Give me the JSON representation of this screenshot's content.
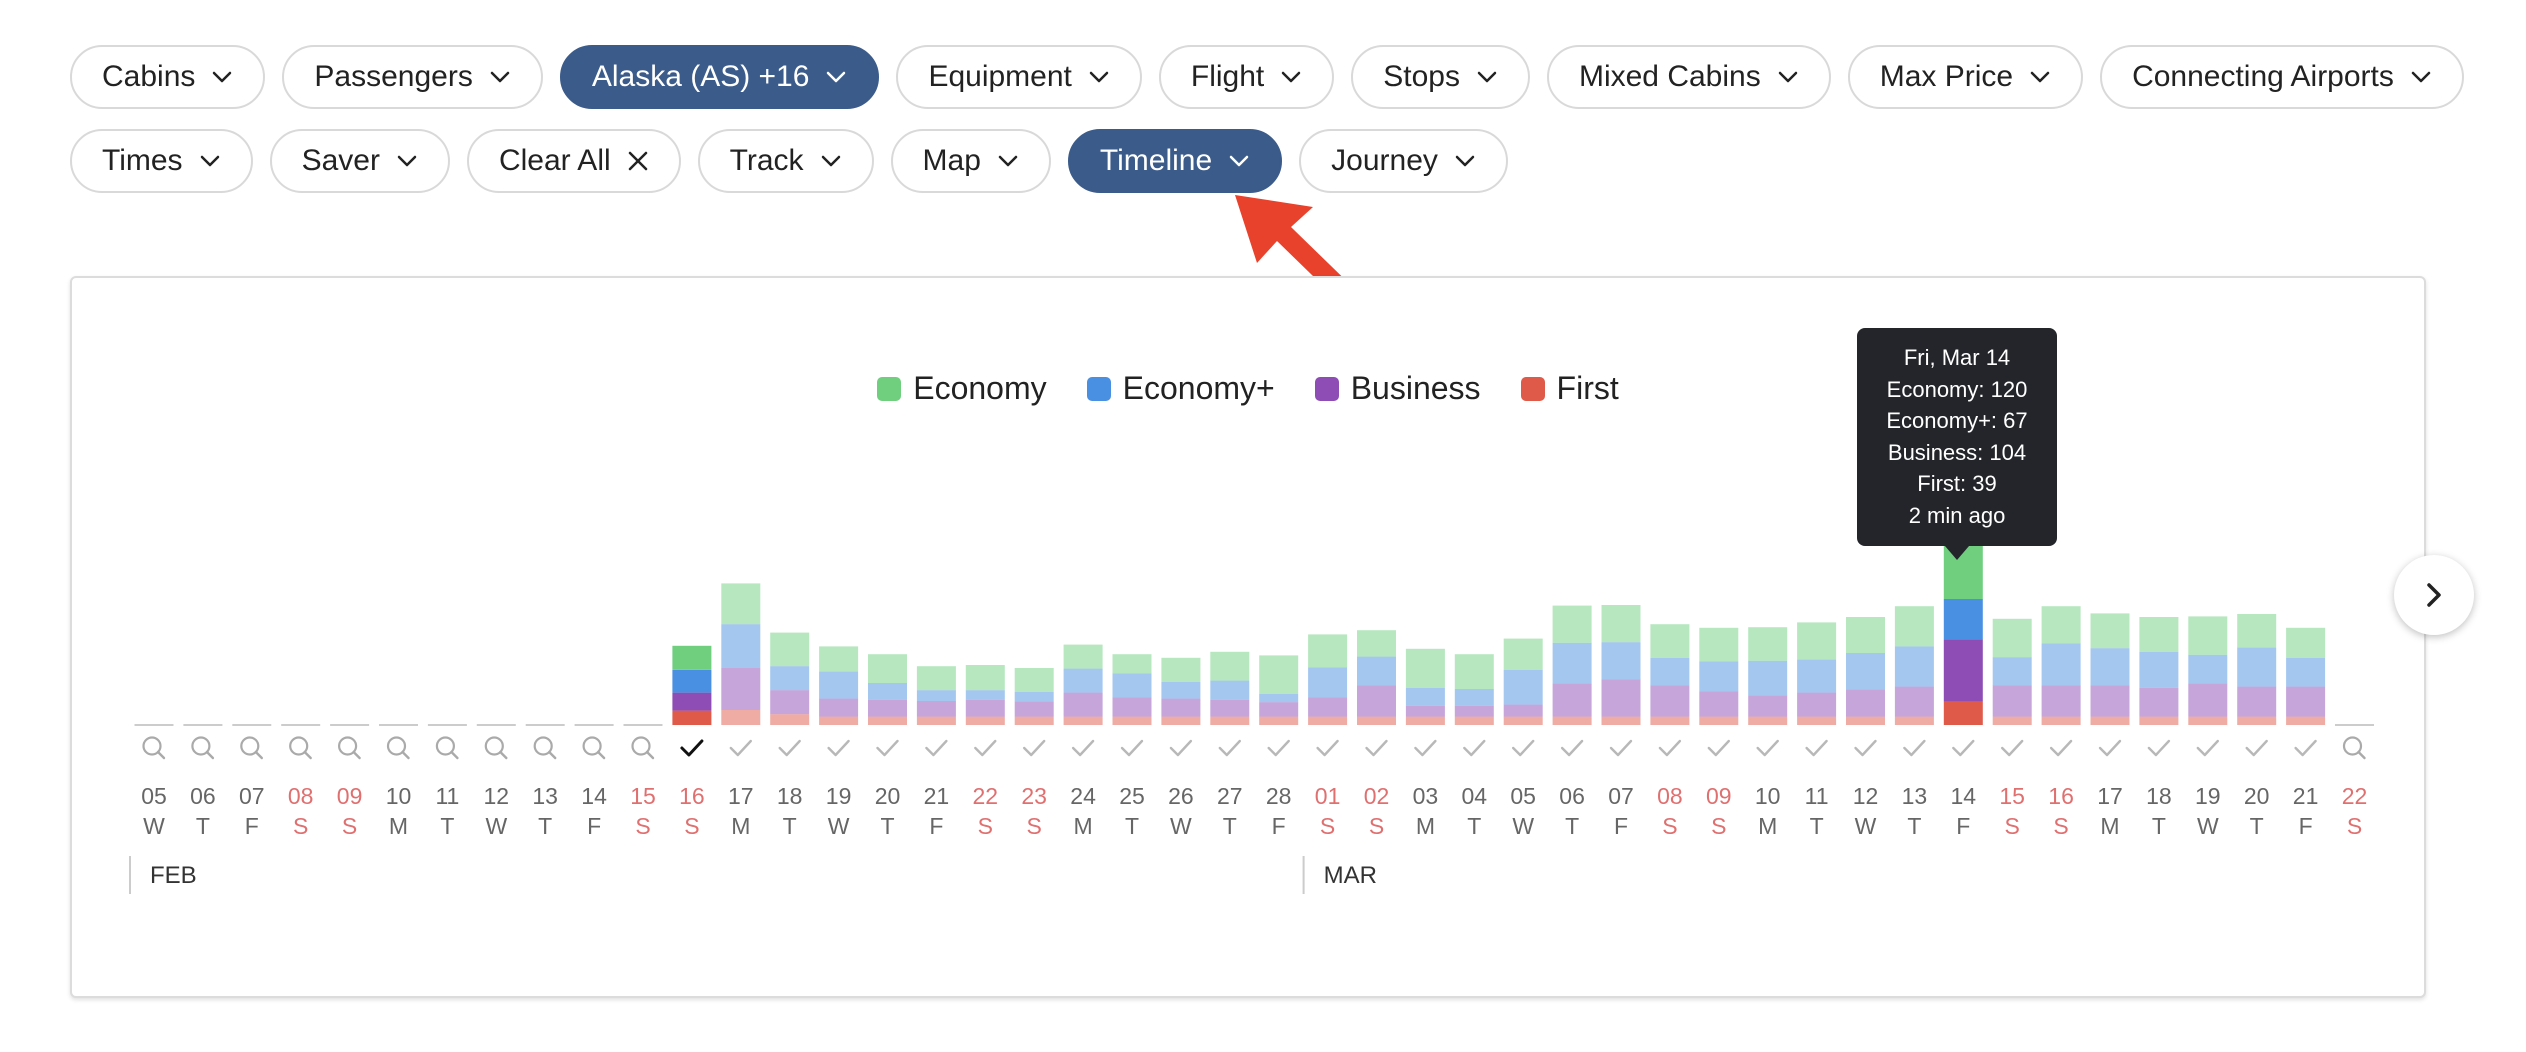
{
  "filters": {
    "row1": [
      {
        "label": "Cabins",
        "active": false,
        "icon": "chevron-down-icon"
      },
      {
        "label": "Passengers",
        "active": false,
        "icon": "chevron-down-icon"
      },
      {
        "label": "Alaska (AS) +16",
        "active": true,
        "icon": "chevron-down-icon"
      },
      {
        "label": "Equipment",
        "active": false,
        "icon": "chevron-down-icon"
      },
      {
        "label": "Flight",
        "active": false,
        "icon": "chevron-down-icon"
      },
      {
        "label": "Stops",
        "active": false,
        "icon": "chevron-down-icon"
      },
      {
        "label": "Mixed Cabins",
        "active": false,
        "icon": "chevron-down-icon"
      },
      {
        "label": "Max Price",
        "active": false,
        "icon": "chevron-down-icon"
      },
      {
        "label": "Connecting Airports",
        "active": false,
        "icon": "chevron-down-icon"
      }
    ],
    "row2": [
      {
        "label": "Times",
        "active": false,
        "icon": "chevron-down-icon"
      },
      {
        "label": "Saver",
        "active": false,
        "icon": "chevron-down-icon"
      },
      {
        "label": "Clear All",
        "active": false,
        "icon": "close-icon"
      },
      {
        "label": "Track",
        "active": false,
        "icon": "chevron-down-icon"
      },
      {
        "label": "Map",
        "active": false,
        "icon": "chevron-down-icon"
      },
      {
        "label": "Timeline",
        "active": true,
        "icon": "chevron-down-icon"
      },
      {
        "label": "Journey",
        "active": false,
        "icon": "chevron-down-icon"
      }
    ]
  },
  "colors": {
    "accent": "#3b5b8a",
    "economy": "#6fcf7f",
    "economy_plus": "#4a90e2",
    "business": "#8e4cb5",
    "first": "#e05a4a",
    "weekend_text": "#e07070",
    "annotation_arrow": "#e8412c"
  },
  "legend": [
    {
      "label": "Economy",
      "color": "#6fcf7f"
    },
    {
      "label": "Economy+",
      "color": "#4a90e2"
    },
    {
      "label": "Business",
      "color": "#8e4cb5"
    },
    {
      "label": "First",
      "color": "#e05a4a"
    }
  ],
  "tooltip": {
    "lines": [
      "Fri, Mar 14",
      "Economy: 120",
      "Economy+: 67",
      "Business: 104",
      "First: 39",
      "2 min ago"
    ]
  },
  "months": [
    "FEB",
    "MAR"
  ],
  "chart_data": {
    "type": "bar",
    "stacked": true,
    "categories": [
      {
        "day": "05",
        "dow": "W",
        "weekend": false,
        "status": "search",
        "month": "FEB"
      },
      {
        "day": "06",
        "dow": "T",
        "weekend": false,
        "status": "search",
        "month": "FEB"
      },
      {
        "day": "07",
        "dow": "F",
        "weekend": false,
        "status": "search",
        "month": "FEB"
      },
      {
        "day": "08",
        "dow": "S",
        "weekend": true,
        "status": "search",
        "month": "FEB"
      },
      {
        "day": "09",
        "dow": "S",
        "weekend": true,
        "status": "search",
        "month": "FEB"
      },
      {
        "day": "10",
        "dow": "M",
        "weekend": false,
        "status": "search",
        "month": "FEB"
      },
      {
        "day": "11",
        "dow": "T",
        "weekend": false,
        "status": "search",
        "month": "FEB"
      },
      {
        "day": "12",
        "dow": "W",
        "weekend": false,
        "status": "search",
        "month": "FEB"
      },
      {
        "day": "13",
        "dow": "T",
        "weekend": false,
        "status": "search",
        "month": "FEB"
      },
      {
        "day": "14",
        "dow": "F",
        "weekend": false,
        "status": "search",
        "month": "FEB"
      },
      {
        "day": "15",
        "dow": "S",
        "weekend": true,
        "status": "search",
        "month": "FEB"
      },
      {
        "day": "16",
        "dow": "S",
        "weekend": true,
        "status": "selected",
        "month": "FEB"
      },
      {
        "day": "17",
        "dow": "M",
        "weekend": false,
        "status": "check",
        "month": "FEB"
      },
      {
        "day": "18",
        "dow": "T",
        "weekend": false,
        "status": "check",
        "month": "FEB"
      },
      {
        "day": "19",
        "dow": "W",
        "weekend": false,
        "status": "check",
        "month": "FEB"
      },
      {
        "day": "20",
        "dow": "T",
        "weekend": false,
        "status": "check",
        "month": "FEB"
      },
      {
        "day": "21",
        "dow": "F",
        "weekend": false,
        "status": "check",
        "month": "FEB"
      },
      {
        "day": "22",
        "dow": "S",
        "weekend": true,
        "status": "check",
        "month": "FEB"
      },
      {
        "day": "23",
        "dow": "S",
        "weekend": true,
        "status": "check",
        "month": "FEB"
      },
      {
        "day": "24",
        "dow": "M",
        "weekend": false,
        "status": "check",
        "month": "FEB"
      },
      {
        "day": "25",
        "dow": "T",
        "weekend": false,
        "status": "check",
        "month": "FEB"
      },
      {
        "day": "26",
        "dow": "W",
        "weekend": false,
        "status": "check",
        "month": "FEB"
      },
      {
        "day": "27",
        "dow": "T",
        "weekend": false,
        "status": "check",
        "month": "FEB"
      },
      {
        "day": "28",
        "dow": "F",
        "weekend": false,
        "status": "check",
        "month": "FEB"
      },
      {
        "day": "01",
        "dow": "S",
        "weekend": true,
        "status": "check",
        "month": "MAR"
      },
      {
        "day": "02",
        "dow": "S",
        "weekend": true,
        "status": "check",
        "month": "MAR"
      },
      {
        "day": "03",
        "dow": "M",
        "weekend": false,
        "status": "check",
        "month": "MAR"
      },
      {
        "day": "04",
        "dow": "T",
        "weekend": false,
        "status": "check",
        "month": "MAR"
      },
      {
        "day": "05",
        "dow": "W",
        "weekend": false,
        "status": "check",
        "month": "MAR"
      },
      {
        "day": "06",
        "dow": "T",
        "weekend": false,
        "status": "check",
        "month": "MAR"
      },
      {
        "day": "07",
        "dow": "F",
        "weekend": false,
        "status": "check",
        "month": "MAR"
      },
      {
        "day": "08",
        "dow": "S",
        "weekend": true,
        "status": "check",
        "month": "MAR"
      },
      {
        "day": "09",
        "dow": "S",
        "weekend": true,
        "status": "check",
        "month": "MAR"
      },
      {
        "day": "10",
        "dow": "M",
        "weekend": false,
        "status": "check",
        "month": "MAR"
      },
      {
        "day": "11",
        "dow": "T",
        "weekend": false,
        "status": "check",
        "month": "MAR"
      },
      {
        "day": "12",
        "dow": "W",
        "weekend": false,
        "status": "check",
        "month": "MAR"
      },
      {
        "day": "13",
        "dow": "T",
        "weekend": false,
        "status": "check",
        "month": "MAR"
      },
      {
        "day": "14",
        "dow": "F",
        "weekend": false,
        "status": "check",
        "month": "MAR"
      },
      {
        "day": "15",
        "dow": "S",
        "weekend": true,
        "status": "check",
        "month": "MAR"
      },
      {
        "day": "16",
        "dow": "S",
        "weekend": true,
        "status": "check",
        "month": "MAR"
      },
      {
        "day": "17",
        "dow": "M",
        "weekend": false,
        "status": "check",
        "month": "MAR"
      },
      {
        "day": "18",
        "dow": "T",
        "weekend": false,
        "status": "check",
        "month": "MAR"
      },
      {
        "day": "19",
        "dow": "W",
        "weekend": false,
        "status": "check",
        "month": "MAR"
      },
      {
        "day": "20",
        "dow": "T",
        "weekend": false,
        "status": "check",
        "month": "MAR"
      },
      {
        "day": "21",
        "dow": "F",
        "weekend": false,
        "status": "check",
        "month": "MAR"
      },
      {
        "day": "22",
        "dow": "S",
        "weekend": true,
        "status": "search",
        "month": "MAR"
      }
    ],
    "series": [
      {
        "name": "First",
        "color": "#e05a4a",
        "values": [
          0,
          0,
          0,
          0,
          0,
          0,
          0,
          0,
          0,
          0,
          0,
          24,
          25,
          18,
          14,
          14,
          14,
          14,
          14,
          14,
          14,
          14,
          14,
          14,
          14,
          14,
          14,
          14,
          14,
          14,
          14,
          14,
          14,
          14,
          14,
          14,
          14,
          39,
          14,
          14,
          14,
          14,
          14,
          14,
          14,
          0
        ]
      },
      {
        "name": "Business",
        "color": "#8e4cb5",
        "values": [
          0,
          0,
          0,
          0,
          0,
          0,
          0,
          0,
          0,
          0,
          0,
          30,
          70,
          40,
          30,
          28,
          26,
          28,
          25,
          40,
          32,
          30,
          28,
          24,
          32,
          52,
          18,
          18,
          20,
          55,
          62,
          52,
          42,
          35,
          40,
          45,
          50,
          104,
          52,
          52,
          52,
          48,
          55,
          50,
          50,
          0
        ]
      },
      {
        "name": "Economy+",
        "color": "#4a90e2",
        "values": [
          0,
          0,
          0,
          0,
          0,
          0,
          0,
          0,
          0,
          0,
          0,
          38,
          73,
          40,
          45,
          28,
          18,
          16,
          16,
          40,
          40,
          28,
          32,
          14,
          50,
          48,
          30,
          28,
          58,
          68,
          62,
          46,
          50,
          58,
          55,
          61,
          67,
          67,
          47,
          70,
          62,
          60,
          48,
          65,
          48,
          0
        ]
      },
      {
        "name": "Economy",
        "color": "#6fcf7f",
        "values": [
          0,
          0,
          0,
          0,
          0,
          0,
          0,
          0,
          0,
          0,
          0,
          40,
          68,
          56,
          42,
          48,
          40,
          42,
          40,
          40,
          32,
          40,
          48,
          64,
          55,
          44,
          65,
          58,
          52,
          62,
          62,
          56,
          56,
          56,
          62,
          60,
          67,
          120,
          64,
          62,
          58,
          58,
          64,
          56,
          50,
          0
        ]
      }
    ],
    "xlabel": "",
    "ylabel": "",
    "grid": false,
    "legend_position": "top-center"
  },
  "next_button": {
    "icon": "chevron-right-icon"
  }
}
